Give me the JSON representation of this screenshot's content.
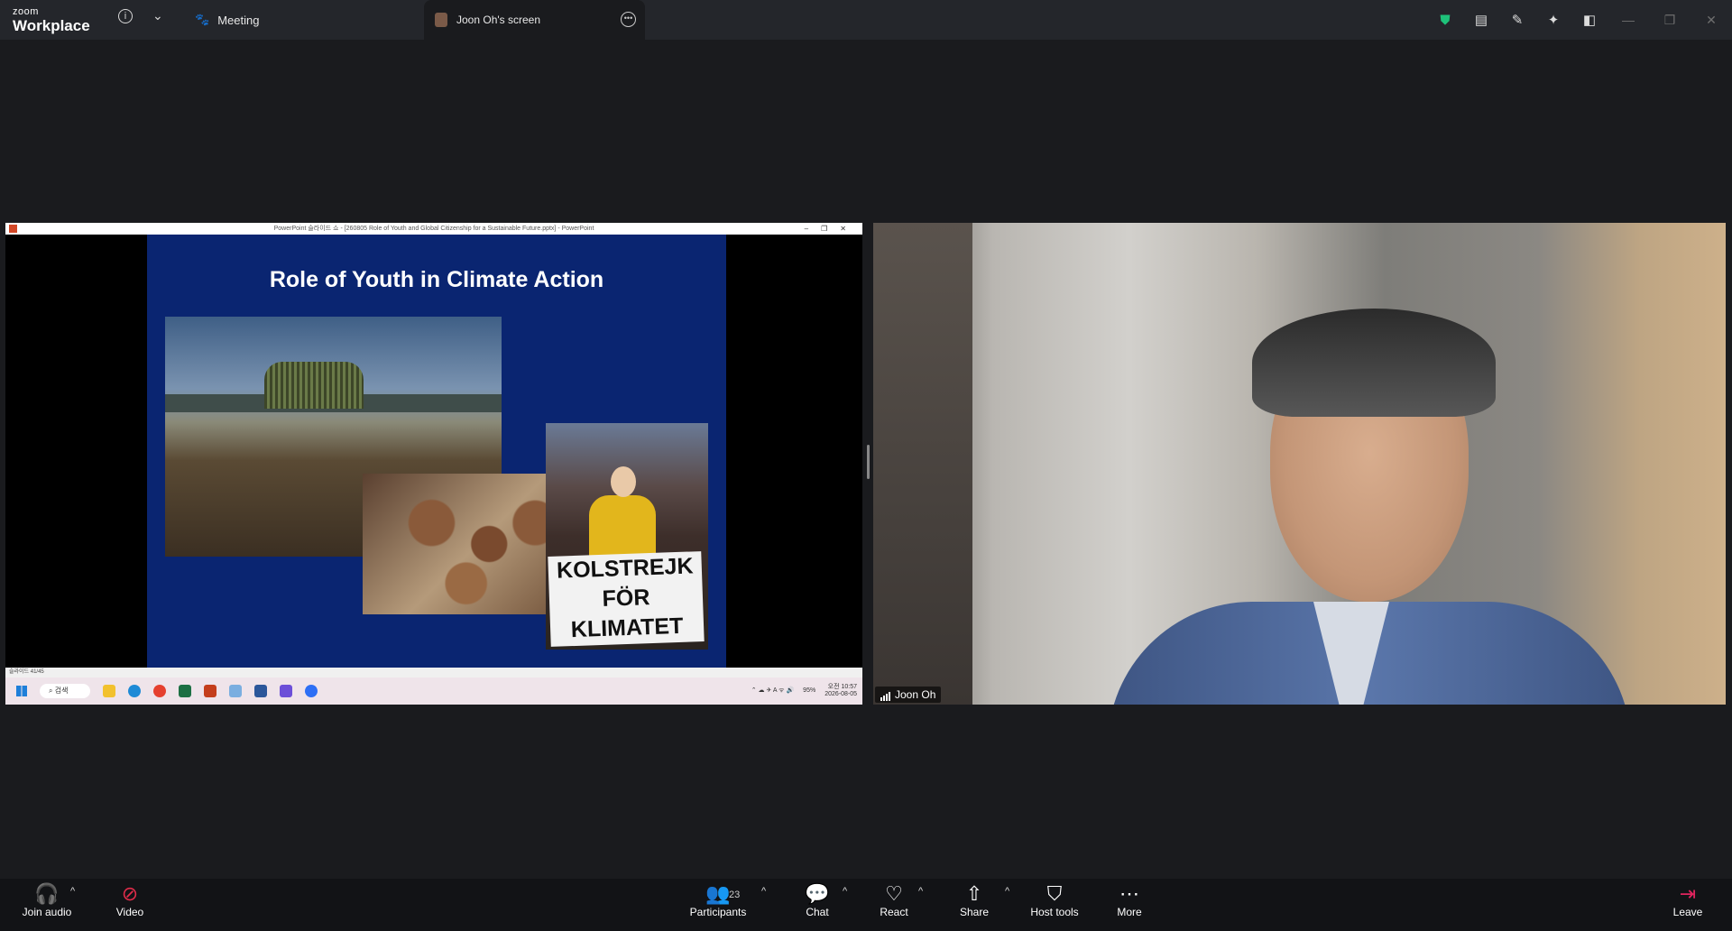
{
  "app": {
    "logo_small": "zoom",
    "logo_big": "Workplace"
  },
  "topbar": {
    "meeting_tab": "Meeting",
    "screen_tab": "Joon Oh's screen",
    "colors": {
      "shield": "#1ec27a"
    }
  },
  "shared_screen": {
    "ppt_window_title": "PowerPoint 슬라이드 쇼 - [260805 Role of Youth and Global Citizenship for a Sustainable Future.pptx] - PowerPoint",
    "slide_title": "Role of Youth in Climate Action",
    "sign_line1": "KOLSTREJK",
    "sign_line2": "FÖR",
    "sign_line3": "KLIMATET",
    "slide_counter": "슬라이드 41/45",
    "taskbar_search": "검색",
    "tray_battery": "95%",
    "tray_time": "오전 10:57",
    "tray_date": "2026-08-05"
  },
  "video": {
    "participant_name": "Joon Oh"
  },
  "toolbar": {
    "join_audio": "Join audio",
    "video": "Video",
    "participants": "Participants",
    "participants_count": "23",
    "chat": "Chat",
    "react": "React",
    "share": "Share",
    "host_tools": "Host tools",
    "more": "More",
    "leave": "Leave"
  }
}
